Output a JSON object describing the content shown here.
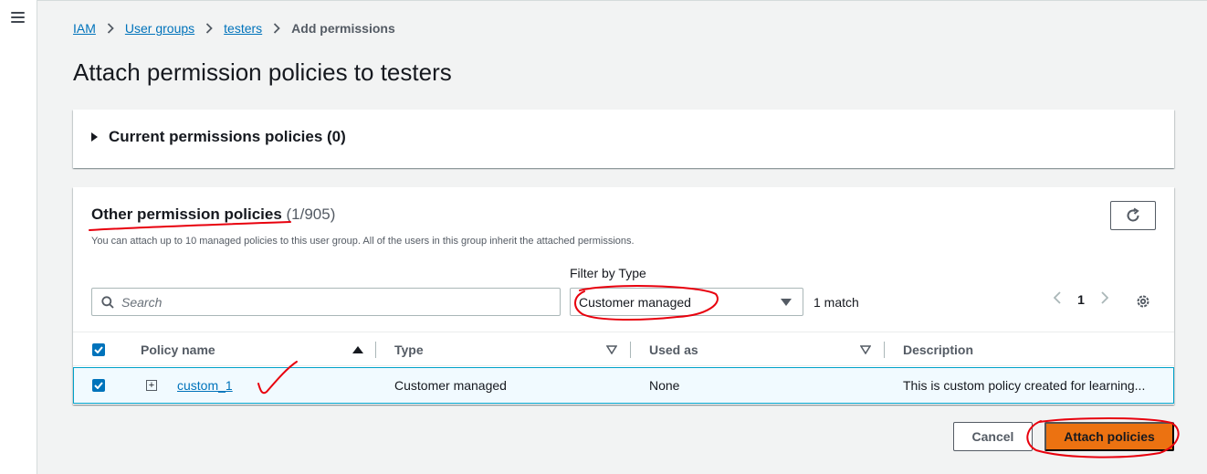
{
  "breadcrumb": {
    "items": [
      {
        "label": "IAM"
      },
      {
        "label": "User groups"
      },
      {
        "label": "testers"
      }
    ],
    "current": "Add permissions"
  },
  "page_title": "Attach permission policies to testers",
  "current_policies": {
    "title": "Current permissions policies (0)"
  },
  "other_policies": {
    "title": "Other permission policies",
    "count": "(1/905)",
    "subtitle": "You can attach up to 10 managed policies to this user group. All of the users in this group inherit the attached permissions.",
    "search_placeholder": "Search",
    "filter_label": "Filter by Type",
    "filter_value": "Customer managed",
    "match_text": "1 match",
    "page": "1",
    "columns": {
      "policy_name": "Policy name",
      "type": "Type",
      "used_as": "Used as",
      "description": "Description"
    },
    "rows": [
      {
        "policy_name": "custom_1",
        "type": "Customer managed",
        "used_as": "None",
        "description": "This is custom policy created for learning..."
      }
    ]
  },
  "footer": {
    "cancel_label": "Cancel",
    "attach_label": "Attach policies"
  },
  "colors": {
    "accent": "#ec7211",
    "link": "#0073bb",
    "annotation": "#e8000d"
  }
}
